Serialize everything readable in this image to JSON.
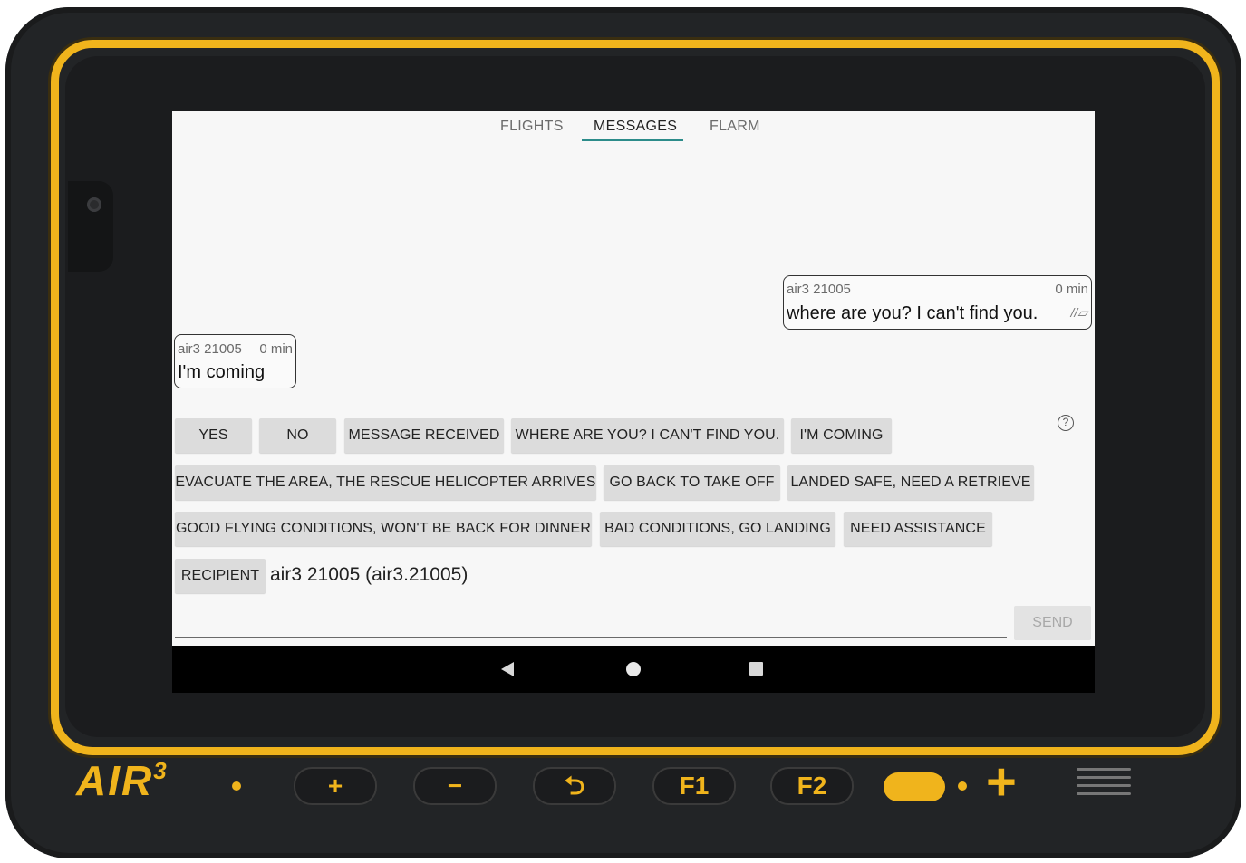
{
  "device": {
    "brand": "AIR",
    "brand_superscript": "3"
  },
  "tabs": [
    {
      "label": "FLIGHTS",
      "active": false
    },
    {
      "label": "MESSAGES",
      "active": true
    },
    {
      "label": "FLARM",
      "active": false
    }
  ],
  "messages": [
    {
      "sender": "air3 21005",
      "time": "0 min",
      "text": "where are you? I can't find you.",
      "status_icon": "double-check-icon"
    },
    {
      "sender": "air3 21005",
      "time": "0 min",
      "text": "I'm coming"
    }
  ],
  "quick_replies": {
    "row1": [
      "YES",
      "NO",
      "MESSAGE RECEIVED",
      "WHERE ARE YOU? I CAN'T FIND YOU.",
      "I'M COMING"
    ],
    "row2": [
      "EVACUATE THE AREA, THE RESCUE HELICOPTER ARRIVES",
      "GO BACK TO TAKE OFF",
      "LANDED SAFE, NEED A RETRIEVE"
    ],
    "row3": [
      "GOOD FLYING CONDITIONS, WON'T BE BACK FOR DINNER",
      "BAD CONDITIONS, GO LANDING",
      "NEED ASSISTANCE"
    ]
  },
  "help_icon": "?",
  "recipient": {
    "button_label": "RECIPIENT",
    "value": "air3 21005 (air3.21005)"
  },
  "compose": {
    "value": "",
    "send_label": "SEND",
    "send_enabled": false
  },
  "hardware_buttons": [
    "+",
    "−",
    "⮌",
    "F1",
    "F2"
  ],
  "colors": {
    "accent": "#2c8c8a",
    "frame_yellow": "#f0b41c",
    "button_bg": "#dcdcdc"
  }
}
